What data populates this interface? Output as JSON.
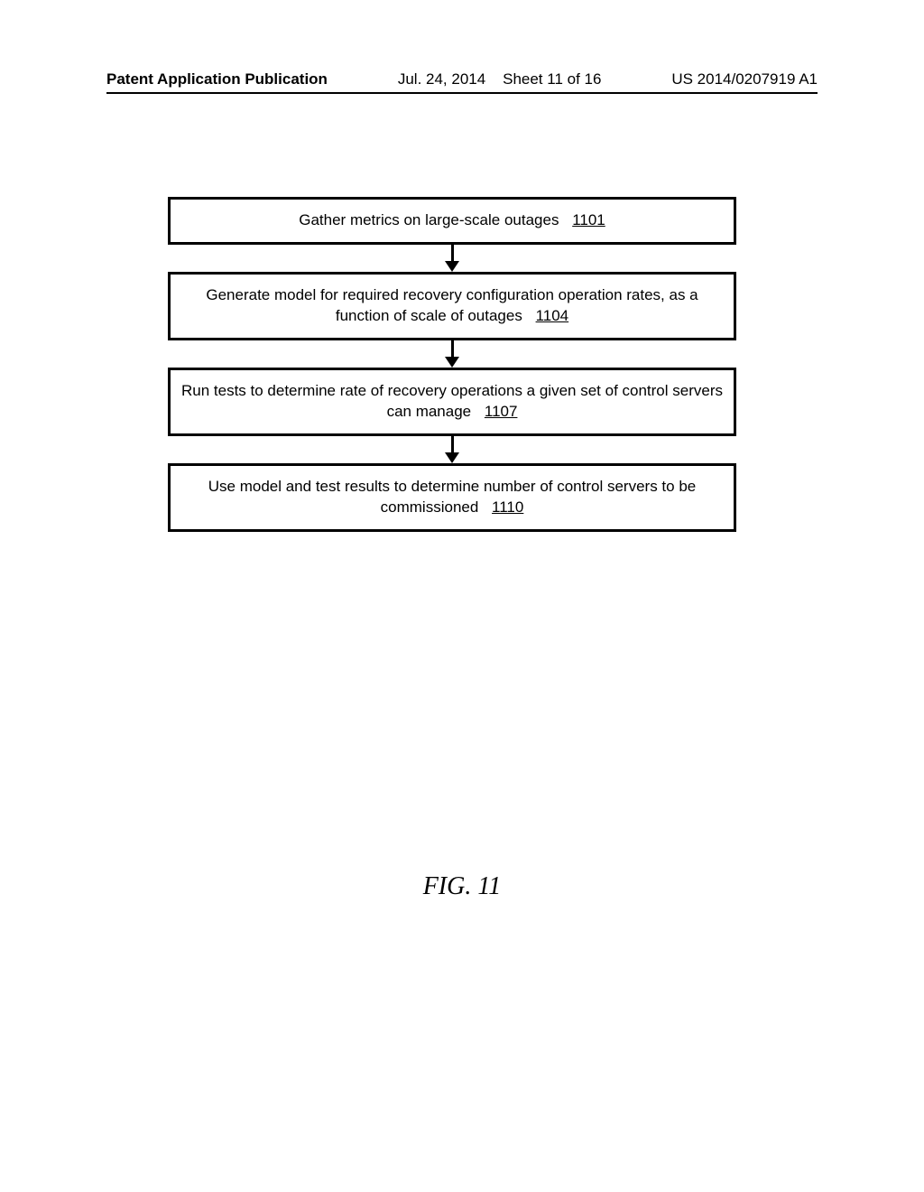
{
  "header": {
    "left": "Patent Application Publication",
    "date": "Jul. 24, 2014",
    "sheet": "Sheet 11 of 16",
    "pubno": "US 2014/0207919 A1"
  },
  "flow": {
    "steps": [
      {
        "text": "Gather metrics on large-scale outages",
        "ref": "1101"
      },
      {
        "text": "Generate model for required recovery configuration operation rates, as a function of scale of outages",
        "ref": "1104"
      },
      {
        "text": "Run tests to determine rate of recovery operations a given set of control servers can manage",
        "ref": "1107"
      },
      {
        "text": "Use model and test results to determine number of control servers to be commissioned",
        "ref": "1110"
      }
    ]
  },
  "figure_label": "FIG. 11"
}
